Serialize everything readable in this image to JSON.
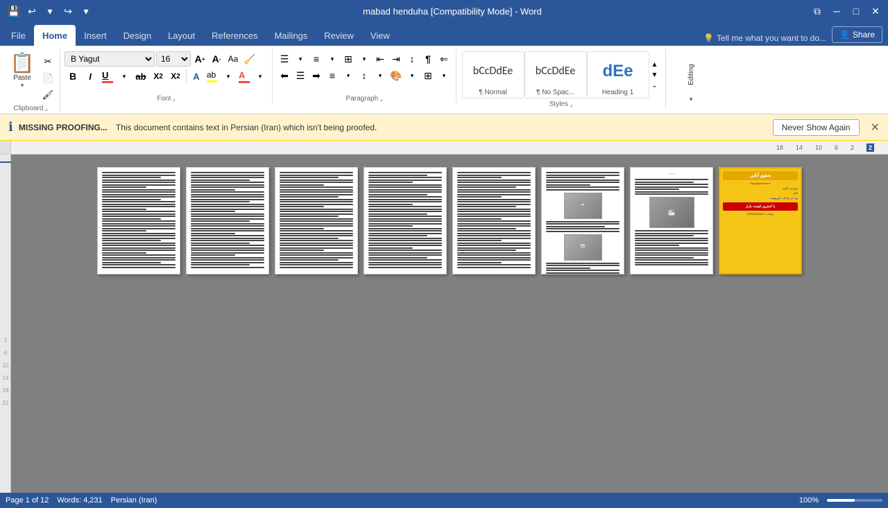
{
  "titlebar": {
    "title": "mabad henduha [Compatibility Mode] - Word",
    "minimize": "─",
    "maximize": "□",
    "close": "✕",
    "restore": "⧉"
  },
  "qat": {
    "save": "💾",
    "undo": "↩",
    "undo_arrow": "▾",
    "redo": "↪",
    "customize": "▾"
  },
  "tabs": {
    "file": "File",
    "home": "Home",
    "insert": "Insert",
    "design": "Design",
    "layout": "Layout",
    "references": "References",
    "mailings": "Mailings",
    "review": "Review",
    "view": "View",
    "tell_me": "Tell me what you want to do...",
    "share": "Share"
  },
  "ribbon": {
    "clipboard_group": "Clipboard",
    "font_group": "Font",
    "paragraph_group": "Paragraph",
    "styles_group": "Styles",
    "editing_label": "Editing",
    "font_name": "B Yagut",
    "font_size": "16",
    "bold": "B",
    "italic": "I",
    "underline": "U",
    "strikethrough": "ab",
    "subscript": "X₂",
    "superscript": "X²",
    "paste_label": "Paste",
    "styles": [
      {
        "name": "Normal",
        "preview_text": "bCcDdEe",
        "preview_style": "normal"
      },
      {
        "name": "No Spac...",
        "preview_text": "bCcDdEe",
        "preview_style": "tight"
      },
      {
        "name": "Heading 1",
        "preview_text": "dEe",
        "preview_style": "heading"
      }
    ]
  },
  "notification": {
    "icon": "ℹ",
    "title": "MISSING PROOFING...",
    "message": "This document contains text in Persian (Iran) which isn't being proofed.",
    "button": "Never Show Again",
    "close": "✕"
  },
  "ruler": {
    "numbers": [
      "18",
      "14",
      "10",
      "6",
      "2",
      "2"
    ]
  },
  "scroll_numbers": [
    "2",
    "6",
    "10",
    "14",
    "18",
    "22"
  ],
  "pages": [
    {
      "id": 1,
      "type": "text",
      "lines": 40
    },
    {
      "id": 2,
      "type": "text",
      "lines": 40
    },
    {
      "id": 3,
      "type": "text",
      "lines": 40
    },
    {
      "id": 4,
      "type": "text",
      "lines": 40
    },
    {
      "id": 5,
      "type": "text",
      "lines": 40
    },
    {
      "id": 6,
      "type": "text_image",
      "lines": 25,
      "images": 2
    },
    {
      "id": 7,
      "type": "text_image",
      "lines": 25,
      "images": 1
    },
    {
      "id": 8,
      "type": "colored"
    }
  ],
  "statusbar": {
    "page_info": "Page 1 of 12",
    "word_count": "Words: 4,231",
    "language": "Persian (Iran)",
    "zoom": "100%"
  }
}
